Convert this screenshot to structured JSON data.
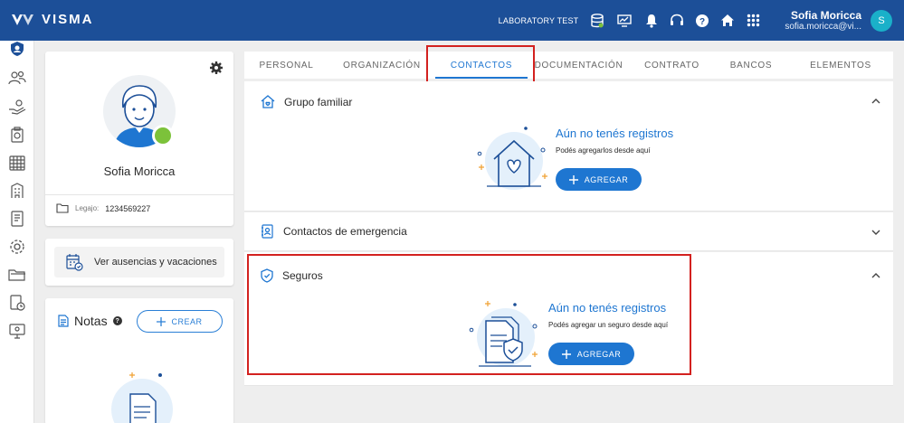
{
  "app": {
    "brand": "VISMA"
  },
  "header": {
    "environment": "LABORATORY TEST",
    "user_name": "Sofia Moricca",
    "user_email": "sofia.moricca@vi...",
    "avatar_initial": "S"
  },
  "profile": {
    "name": "Sofia Moricca",
    "legajo_label": "Legajo:",
    "legajo_value": "1234569227",
    "status_color": "#7cc23a"
  },
  "absences": {
    "label": "Ver ausencias y vacaciones"
  },
  "notes": {
    "title": "Notas",
    "create_label": "CREAR"
  },
  "tabs": [
    {
      "label": "PERSONAL"
    },
    {
      "label": "ORGANIZACIÓN"
    },
    {
      "label": "CONTACTOS"
    },
    {
      "label": "DOCUMENTACIÓN"
    },
    {
      "label": "CONTRATO"
    },
    {
      "label": "BANCOS"
    },
    {
      "label": "ELEMENTOS"
    }
  ],
  "active_tab": "CONTACTOS",
  "sections": {
    "family": {
      "title": "Grupo familiar",
      "empty_title": "Aún no tenés registros",
      "empty_sub": "Podés agregarlos desde aquí",
      "button": "AGREGAR"
    },
    "emergency": {
      "title": "Contactos de emergencia"
    },
    "insurance": {
      "title": "Seguros",
      "empty_title": "Aún no tenés registros",
      "empty_sub": "Podés agregar un seguro desde aquí",
      "button": "AGREGAR"
    }
  },
  "colors": {
    "header": "#1c4f98",
    "accent": "#1e76d1",
    "highlight": "#d3211f"
  }
}
